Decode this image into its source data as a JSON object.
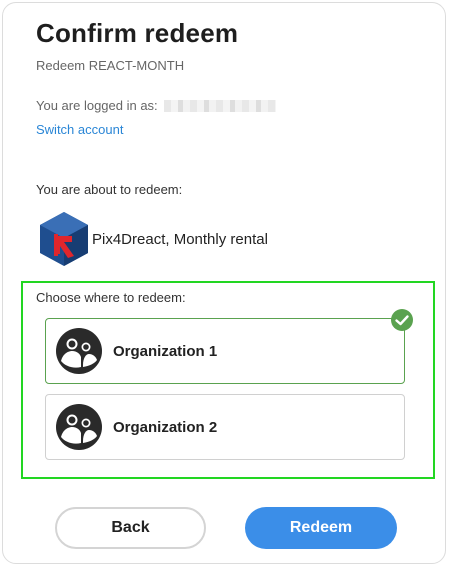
{
  "header": {
    "title": "Confirm redeem",
    "subtitle": "Redeem REACT-MONTH"
  },
  "account": {
    "logged_in_label": "You are logged in as:",
    "switch_label": "Switch account"
  },
  "product": {
    "about_label": "You are about to redeem:",
    "name": "Pix4Dreact, Monthly rental",
    "logo_icon": "pix4dreact-logo-icon"
  },
  "choose": {
    "label": "Choose where to redeem:",
    "options": [
      {
        "name": "Organization 1",
        "selected": true,
        "icon": "organization-avatar-icon"
      },
      {
        "name": "Organization 2",
        "selected": false,
        "icon": "organization-avatar-icon"
      }
    ]
  },
  "actions": {
    "back_label": "Back",
    "redeem_label": "Redeem"
  },
  "colors": {
    "accent": "#3b8ee8",
    "link": "#2a86d6",
    "highlight": "#22d622",
    "selected_check": "#5aa24f"
  }
}
